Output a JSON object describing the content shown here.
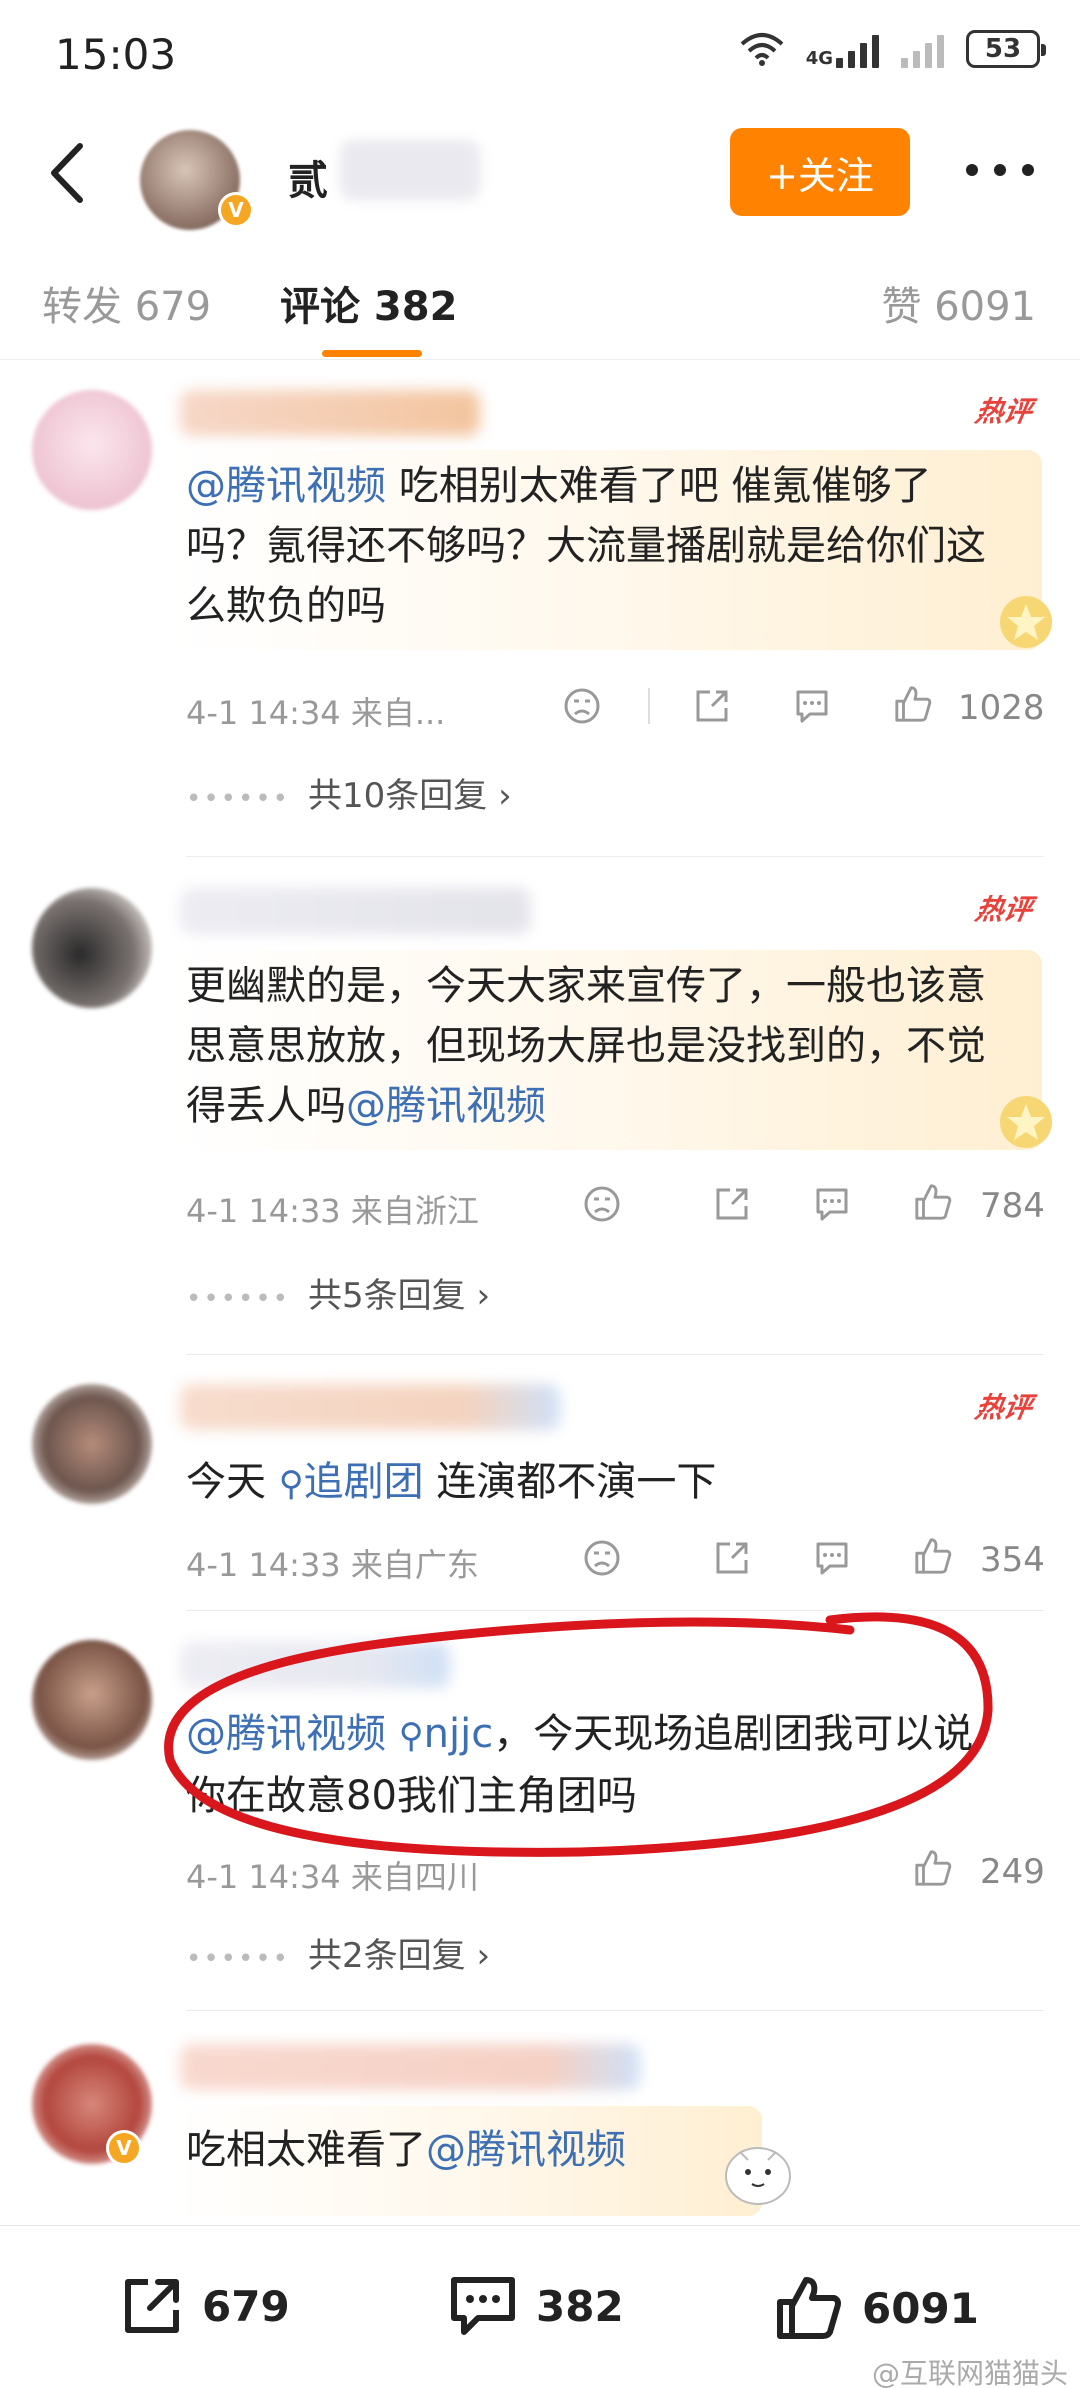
{
  "status_bar": {
    "time": "15:03",
    "network": "4G",
    "battery": "53"
  },
  "header": {
    "username": "贰",
    "follow_label": "+关注"
  },
  "tabs": [
    {
      "label": "转发 679"
    },
    {
      "label": "评论 382"
    },
    {
      "label": "赞 6091"
    }
  ],
  "hot_label": "热评",
  "comments": [
    {
      "mention": "@腾讯视频",
      "text": " 吃相别太难看了吧  催氪催够了吗？氪得还不够吗？大流量播剧就是给你们这么欺负的吗",
      "time": "4-1 14:34",
      "location": "来自...",
      "likes": "1028",
      "replies": "共10条回复"
    },
    {
      "text": "更幽默的是，今天大家来宣传了，一般也该意思意思放放，但现场大屏也是没找到的，不觉得丢人吗",
      "mention": "@腾讯视频",
      "time": "4-1 14:33",
      "location": "来自浙江",
      "likes": "784",
      "replies": "共5条回复"
    },
    {
      "text_pre": "今天 ",
      "topic": "追剧团",
      "text_post": " 连演都不演一下",
      "time": "4-1 14:33",
      "location": "来自广东",
      "likes": "354"
    },
    {
      "mention": "@腾讯视频",
      "topic": "njjc",
      "text": "，今天现场追剧团我可以说你在故意80我们主角团吗",
      "time": "4-1 14:34",
      "location": "来自四川",
      "likes": "249",
      "replies": "共2条回复"
    },
    {
      "text": "吃相太难看了",
      "mention": "@腾讯视频"
    }
  ],
  "bottom_bar": {
    "reposts": "679",
    "comments": "382",
    "likes": "6091"
  },
  "watermark": "@互联网猫猫头",
  "colors": {
    "accent": "#ff8200",
    "link": "#3d6fb4",
    "hot": "#e8423c",
    "annotation": "#d8161c"
  }
}
